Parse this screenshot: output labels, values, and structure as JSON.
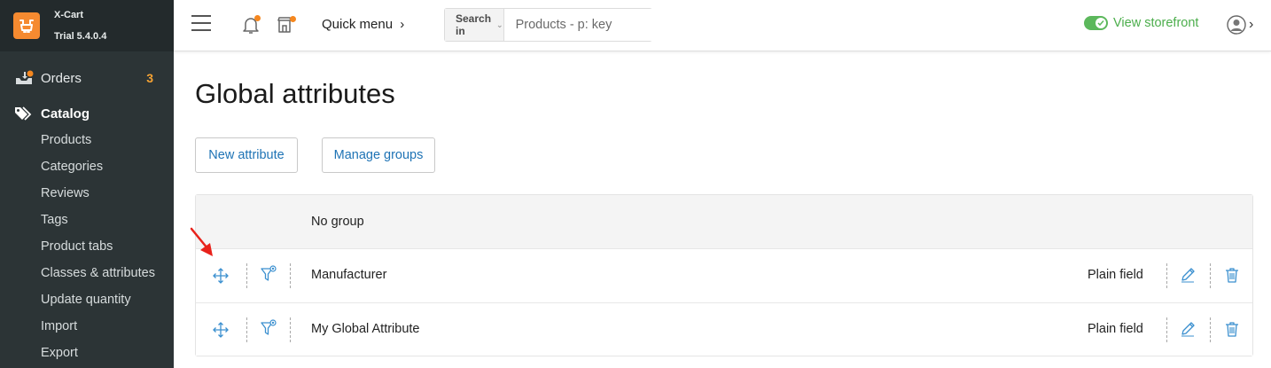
{
  "app": {
    "name": "X-Cart",
    "version": "Trial 5.4.0.4"
  },
  "sidebar": {
    "orders": {
      "label": "Orders",
      "badge": "3"
    },
    "catalog": {
      "label": "Catalog",
      "items": [
        {
          "label": "Products"
        },
        {
          "label": "Categories"
        },
        {
          "label": "Reviews"
        },
        {
          "label": "Tags"
        },
        {
          "label": "Product tabs"
        },
        {
          "label": "Classes & attributes"
        },
        {
          "label": "Update quantity"
        },
        {
          "label": "Import"
        },
        {
          "label": "Export"
        }
      ]
    }
  },
  "header": {
    "quick_menu": "Quick menu",
    "search": {
      "scope_label": "Search in",
      "placeholder": "Products - p: key"
    },
    "storefront_label": "View storefront"
  },
  "main": {
    "title": "Global attributes",
    "buttons": {
      "new_attribute": "New attribute",
      "manage_groups": "Manage groups"
    },
    "table": {
      "group_label": "No group",
      "rows": [
        {
          "name": "Manufacturer",
          "type": "Plain field"
        },
        {
          "name": "My Global Attribute",
          "type": "Plain field"
        }
      ]
    }
  },
  "colors": {
    "sidebar_bg": "#2c3436",
    "accent_orange": "#f58a30",
    "link_blue": "#1e73b5",
    "icon_blue": "#3a8fcf",
    "storefront_green": "#4cae4c",
    "annotation_red": "#e8221b"
  },
  "icons": {
    "logo": "xcart-cart-logo",
    "orders": "orders-tray-icon",
    "catalog": "tags-icon",
    "notifications": "bell-icon",
    "marketplace": "store-icon",
    "user": "user-circle-icon",
    "move": "move-arrows-icon",
    "filter": "filter-icon",
    "edit": "pencil-icon",
    "delete": "trash-icon"
  }
}
